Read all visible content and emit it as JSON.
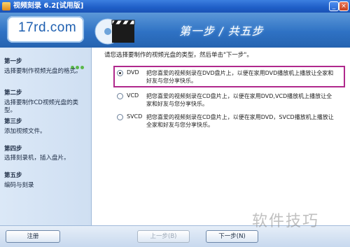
{
  "window": {
    "title": "视频刻录 6.2[试用版]",
    "minimize_glyph": "_",
    "close_glyph": "×"
  },
  "header": {
    "logo": "17rd.com",
    "step_banner": "第一步 / 共五步"
  },
  "sidebar": {
    "steps": [
      {
        "title": "第一步",
        "desc": "选择要制作视频光盘的格式。"
      },
      {
        "title": "第二步",
        "desc": "选择要制作CD视频光盘的类型。"
      },
      {
        "title": "第三步",
        "desc": "添加视频文件。"
      },
      {
        "title": "第四步",
        "desc": "选择刻录机，插入盘片。"
      },
      {
        "title": "第五步",
        "desc": "编码与刻录"
      }
    ]
  },
  "main": {
    "instruction": "请您选择要制作的视频光盘的类型，然后单击\"下一步\"。",
    "options": [
      {
        "label": "DVD",
        "selected": true,
        "desc": "把您喜爱的视频刻录在DVD盘片上，以便在家用DVD播放机上播放让全家和好友与您分享快乐。"
      },
      {
        "label": "VCD",
        "selected": false,
        "desc": "把您喜爱的视频刻录在CD盘片上，以便在家用DVD,VCD播放机上播放让全家和好友与您分享快乐。"
      },
      {
        "label": "SVCD",
        "selected": false,
        "desc": "把您喜爱的视频刻录在CD盘片上，以便在家用DVD，SVCD播放机上播放让全家和好友与您分享快乐。"
      }
    ]
  },
  "buttons": {
    "register": "注册",
    "prev": "上一步(B)",
    "next": "下一步(N)"
  },
  "watermark": "软件技巧",
  "colors": {
    "title_bar": "#2a66cf",
    "header": "#2f72c4",
    "highlight": "#b0288c",
    "progress": "#5ab84a"
  }
}
